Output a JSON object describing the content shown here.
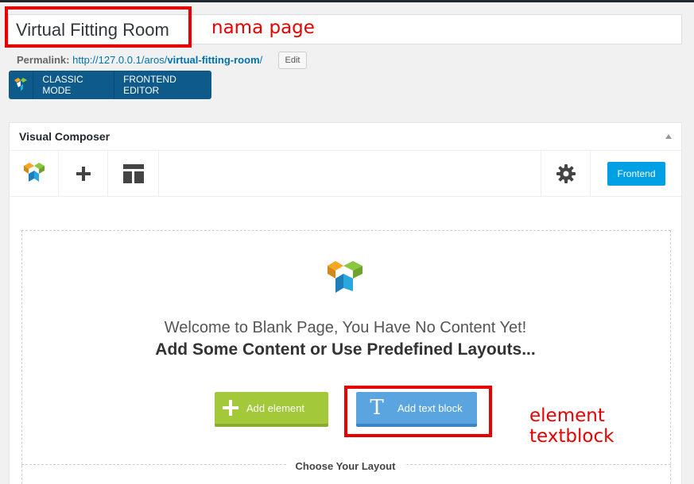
{
  "page": {
    "title": "Virtual Fitting Room",
    "permalink_label": "Permalink:",
    "permalink_base": "http://127.0.0.1/aros/",
    "permalink_slug": "virtual-fitting-room",
    "permalink_tail": "/",
    "edit_label": "Edit"
  },
  "editor_modes": {
    "classic": "CLASSIC MODE",
    "frontend": "FRONTEND EDITOR"
  },
  "composer": {
    "title": "Visual Composer",
    "frontend_button": "Frontend",
    "welcome_line1": "Welcome to Blank Page, You Have No Content Yet!",
    "welcome_line2": "Add Some Content or Use Predefined Layouts...",
    "add_element": "Add element",
    "add_text_block": "Add text block",
    "choose_layout": "Choose Your Layout"
  },
  "annotations": {
    "page_name": "nama page",
    "text_block": "element textblock"
  },
  "colors": {
    "annotation": "#e60000",
    "mode_bar": "#0d5a8b",
    "frontend_button": "#00a0e4",
    "add_element": "#a3c93a",
    "add_text_block": "#5aa5e0"
  },
  "icons": [
    "vc-logo-icon",
    "plus-icon",
    "layout-icon",
    "gear-icon",
    "collapse-arrow-icon",
    "text-icon"
  ]
}
